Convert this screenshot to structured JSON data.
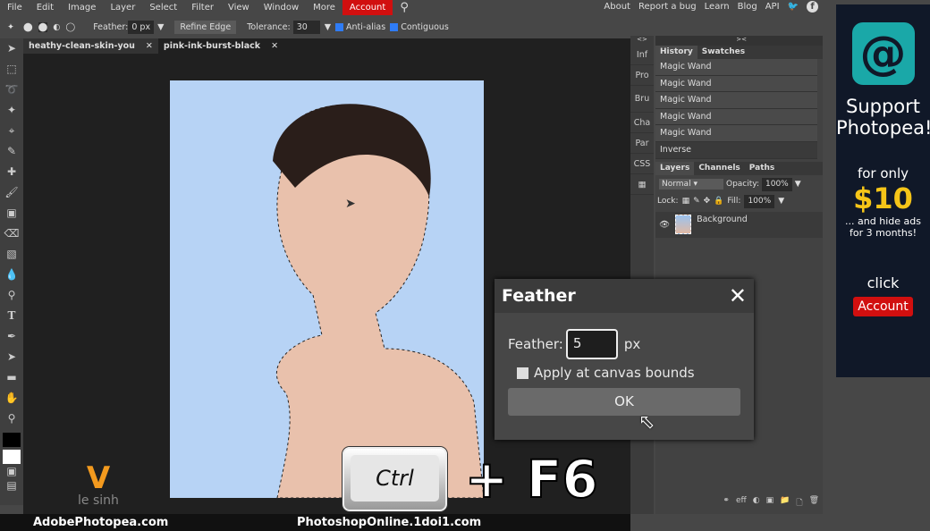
{
  "menu": {
    "items": [
      "File",
      "Edit",
      "Image",
      "Layer",
      "Select",
      "Filter",
      "View",
      "Window",
      "More"
    ],
    "account": "Account",
    "links": [
      "About",
      "Report a bug",
      "Learn",
      "Blog",
      "API"
    ]
  },
  "options": {
    "feather_label": "Feather:",
    "feather_value": "0",
    "feather_unit": "px",
    "refine": "Refine Edge",
    "tolerance_label": "Tolerance:",
    "tolerance_value": "30",
    "antialias": "Anti-alias",
    "contiguous": "Contiguous"
  },
  "tabs": [
    {
      "label": "heathy-clean-skin-you"
    },
    {
      "label": "pink-ink-burst-black"
    }
  ],
  "sidecol": [
    "Inf",
    "Pro",
    "Bru",
    "Cha",
    "Par",
    "CSS"
  ],
  "history": {
    "tabs": [
      "History",
      "Swatches"
    ],
    "items": [
      "Magic Wand",
      "Magic Wand",
      "Magic Wand",
      "Magic Wand",
      "Magic Wand",
      "Inverse"
    ]
  },
  "layers": {
    "tabs": [
      "Layers",
      "Channels",
      "Paths"
    ],
    "blend": "Normal",
    "opacity_label": "Opacity:",
    "opacity": "100%",
    "lock_label": "Lock:",
    "fill_label": "Fill:",
    "fill": "100%",
    "items": [
      {
        "name": "Background"
      }
    ]
  },
  "ad": {
    "line1": "Support",
    "line2": "Photopea!",
    "for_only": "for only",
    "price": "$10",
    "note1": "... and hide ads",
    "note2": "for 3 months!",
    "click": "click",
    "account": "Account",
    "price_color": "#f5c518"
  },
  "dialog": {
    "title": "Feather",
    "label": "Feather:",
    "value": "5",
    "unit": "px",
    "checkbox": "Apply at canvas bounds",
    "ok": "OK"
  },
  "overlay": {
    "key": "Ctrl",
    "plus": "+ F6",
    "left_site": "AdobePhotopea.com",
    "right_site": "PhotoshopOnline.1doi1.com",
    "logo": "le sinh"
  },
  "colors": {
    "account": "#d10f0f",
    "logo": "#f39a1e"
  }
}
